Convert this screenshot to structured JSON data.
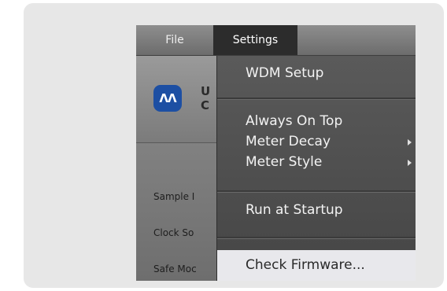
{
  "menubar": {
    "items": [
      "File",
      "Settings"
    ]
  },
  "app": {
    "logo_icon": "presonus-logo-icon",
    "logo_text_lines": [
      "U",
      "C"
    ],
    "labels": [
      "Sample I",
      "Clock So",
      "Safe Moc"
    ]
  },
  "dropdown": {
    "items": [
      {
        "label": "WDM Setup",
        "has_submenu": false
      },
      {
        "label": "Always On Top",
        "has_submenu": false
      },
      {
        "label": "Meter Decay",
        "has_submenu": true
      },
      {
        "label": "Meter Style",
        "has_submenu": true
      },
      {
        "label": "Run at Startup",
        "has_submenu": false
      },
      {
        "label": "Check Firmware...",
        "has_submenu": false,
        "highlighted": true
      }
    ]
  },
  "colors": {
    "menu_active": "#2c2c2c",
    "menu_bg": "#4a4a4a",
    "highlight": "#e8e8ec",
    "logo": "#1d4fa3"
  }
}
